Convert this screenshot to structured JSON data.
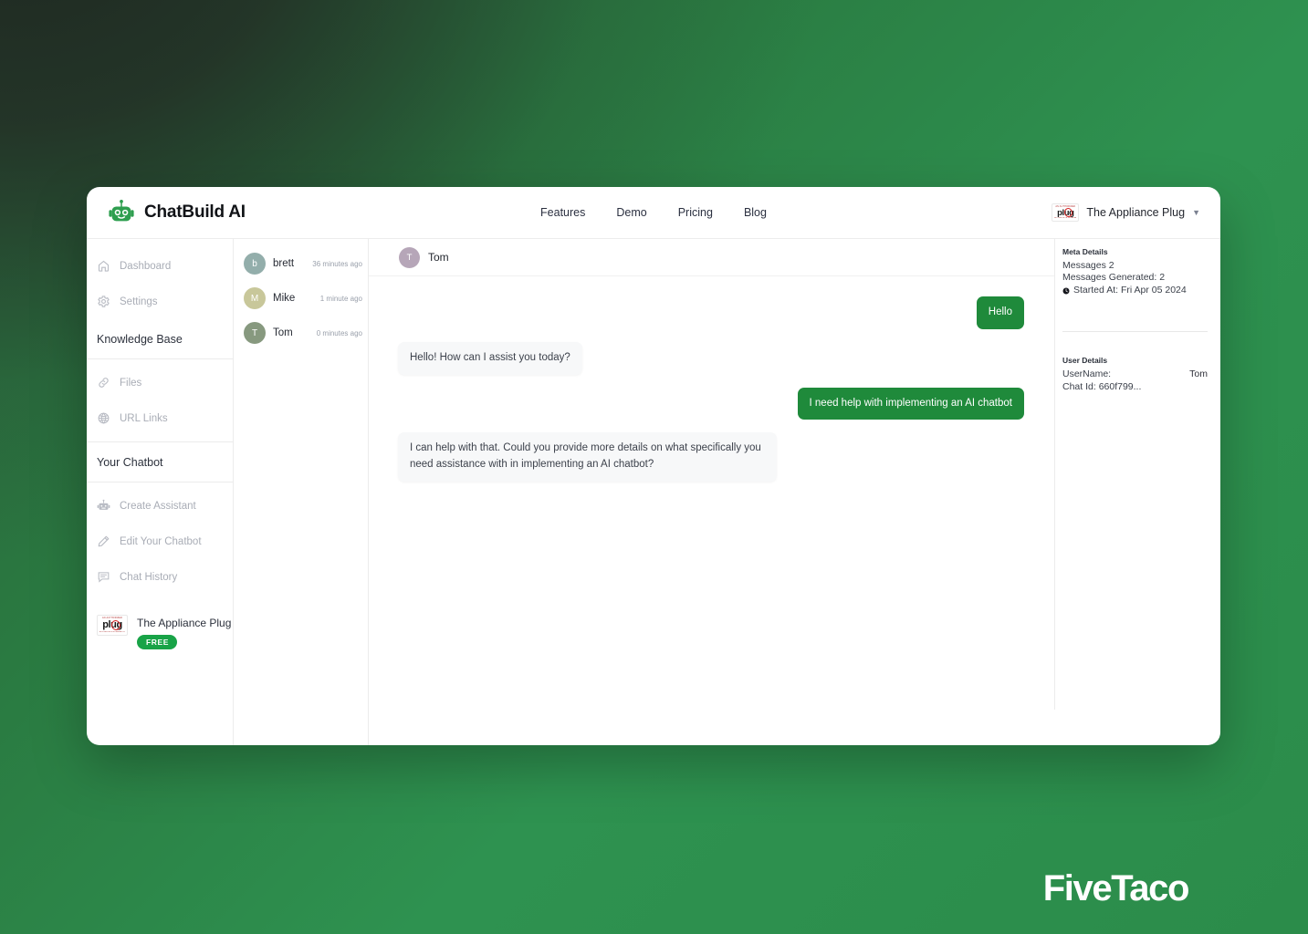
{
  "background": {
    "gradient_from": "#333c35",
    "gradient_to": "#2c8c48",
    "accent_green": "#1f8a3b"
  },
  "watermark": {
    "text": "FiveTaco"
  },
  "header": {
    "brand_name": "ChatBuild AI",
    "brand_logo_icon": "robot-icon",
    "nav": [
      {
        "label": "Features"
      },
      {
        "label": "Demo"
      },
      {
        "label": "Pricing"
      },
      {
        "label": "Blog"
      }
    ],
    "account": {
      "logo_icon": "plug-logo-icon",
      "logo_word": "plug",
      "logo_top_text": "AN AUTHORIZED",
      "logo_bottom_text": "A COMPLETE HOME APPLIANCE",
      "name": "The Appliance Plug",
      "chevron_icon": "chevron-down-icon"
    }
  },
  "sidebar": {
    "items": [
      {
        "label": "Dashboard",
        "icon": "home-icon"
      },
      {
        "label": "Settings",
        "icon": "gear-icon"
      }
    ],
    "knowledge_base_heading": "Knowledge Base",
    "knowledge_items": [
      {
        "label": "Files",
        "icon": "link-icon"
      },
      {
        "label": "URL Links",
        "icon": "globe-icon"
      }
    ],
    "chatbot_heading": "Your Chatbot",
    "chatbot_items": [
      {
        "label": "Create Assistant",
        "icon": "robot-icon"
      },
      {
        "label": "Edit Your Chatbot",
        "icon": "pencil-icon"
      },
      {
        "label": "Chat History",
        "icon": "chat-list-icon"
      }
    ],
    "workspace": {
      "name": "The Appliance Plug",
      "badge": "FREE",
      "logo_icon": "plug-logo-icon",
      "logo_word": "plug",
      "logo_top_text": "AN AUTHORIZED",
      "logo_bottom_text": "A COMPLETE HOME APPLIANCE"
    }
  },
  "conversations": [
    {
      "initial": "b",
      "name": "brett",
      "time": "36 minutes ago",
      "color": "#93aeab"
    },
    {
      "initial": "M",
      "name": "Mike",
      "time": "1 minute ago",
      "color": "#c8c79a"
    },
    {
      "initial": "T",
      "name": "Tom",
      "time": "0 minutes ago",
      "color": "#87997f"
    }
  ],
  "chat": {
    "header": {
      "initial": "T",
      "name": "Tom",
      "avatar_color": "#b6a6b8"
    },
    "messages": [
      {
        "side": "out",
        "text": "Hello"
      },
      {
        "side": "in",
        "text": "Hello! How can I assist you today?"
      },
      {
        "side": "out",
        "text": "I need help with implementing an AI chatbot"
      },
      {
        "side": "in",
        "text": "I can help with that. Could you provide more details on what specifically you need assistance with in implementing an AI chatbot?"
      }
    ]
  },
  "meta_panel": {
    "meta_title": "Meta Details",
    "messages": "Messages 2",
    "messages_generated": "Messages Generated: 2",
    "started_at": "Started At: Fri Apr 05 2024",
    "clock_icon": "clock-icon",
    "user_title": "User Details",
    "username_label": "UserName:",
    "username_value": "Tom",
    "chat_id": "Chat Id: 660f799..."
  }
}
